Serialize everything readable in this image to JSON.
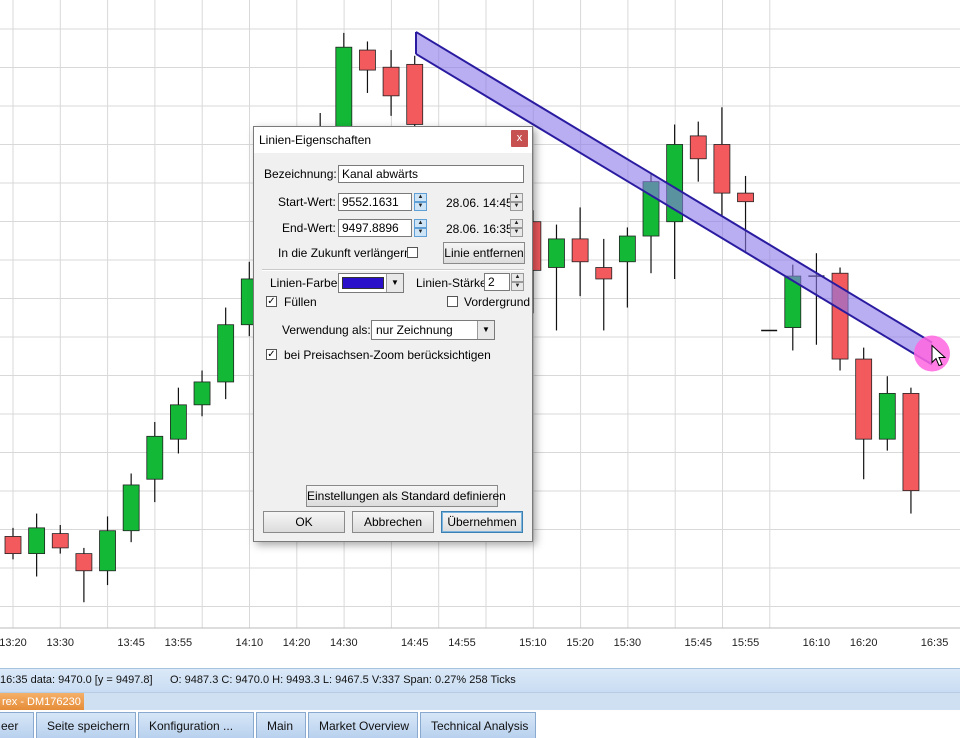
{
  "chart_data": {
    "type": "candlestick",
    "x_ticks": [
      "13:20",
      "13:30",
      "13:45",
      "13:55",
      "14:10",
      "14:20",
      "14:30",
      "14:45",
      "14:55",
      "15:10",
      "15:20",
      "15:30",
      "15:45",
      "15:55",
      "16:10",
      "16:20",
      "16:35"
    ],
    "ylim": [
      9448,
      9556
    ],
    "colors": {
      "up": "#12b836",
      "down": "#f25a5e",
      "grid": "#d9d9d9",
      "channel_fill": "#8a78e8",
      "channel_edge": "#2a1ca0",
      "cursor": "#ff66e0"
    },
    "candles": [
      {
        "x": 0,
        "o": 9464.0,
        "h": 9465.5,
        "l": 9460.0,
        "c": 9461.0
      },
      {
        "x": 1,
        "o": 9461.0,
        "h": 9468.0,
        "l": 9457.0,
        "c": 9465.5
      },
      {
        "x": 2,
        "o": 9464.5,
        "h": 9466.0,
        "l": 9461.0,
        "c": 9462.0
      },
      {
        "x": 3,
        "o": 9461.0,
        "h": 9462.0,
        "l": 9452.5,
        "c": 9458.0
      },
      {
        "x": 4,
        "o": 9458.0,
        "h": 9467.5,
        "l": 9455.5,
        "c": 9465.0
      },
      {
        "x": 5,
        "o": 9465.0,
        "h": 9475.0,
        "l": 9463.0,
        "c": 9473.0
      },
      {
        "x": 6,
        "o": 9474.0,
        "h": 9484.0,
        "l": 9470.0,
        "c": 9481.5
      },
      {
        "x": 7,
        "o": 9481.0,
        "h": 9490.0,
        "l": 9478.5,
        "c": 9487.0
      },
      {
        "x": 8,
        "o": 9487.0,
        "h": 9493.0,
        "l": 9485.0,
        "c": 9491.0
      },
      {
        "x": 9,
        "o": 9491.0,
        "h": 9504.0,
        "l": 9488.0,
        "c": 9501.0
      },
      {
        "x": 10,
        "o": 9501.0,
        "h": 9512.0,
        "l": 9499.0,
        "c": 9509.0
      },
      {
        "x": 11,
        "o": 9509.0,
        "h": 9520.0,
        "l": 9507.0,
        "c": 9518.0
      },
      {
        "x": 12,
        "o": 9520.0,
        "h": 9530.0,
        "l": 9518.0,
        "c": 9528.0
      },
      {
        "x": 13,
        "o": 9528.0,
        "h": 9538.0,
        "l": 9526.0,
        "c": 9535.0
      },
      {
        "x": 14,
        "o": 9535.0,
        "h": 9552.0,
        "l": 9534.0,
        "c": 9549.5
      },
      {
        "x": 15,
        "o": 9549.0,
        "h": 9550.5,
        "l": 9541.5,
        "c": 9545.5
      },
      {
        "x": 16,
        "o": 9546.0,
        "h": 9549.0,
        "l": 9537.5,
        "c": 9541.0
      },
      {
        "x": 17,
        "o": 9546.5,
        "h": 9548.0,
        "l": 9532.5,
        "c": 9536.0
      },
      {
        "x": 18,
        "o": 9535.0,
        "h": 9535.5,
        "l": 9526.0,
        "c": 9530.0
      },
      {
        "x": 19,
        "o": 9528.0,
        "h": 9529.0,
        "l": 9513.0,
        "c": 9521.0
      },
      {
        "x": 20,
        "o": 9519.0,
        "h": 9523.0,
        "l": 9504.5,
        "c": 9511.0
      },
      {
        "x": 21,
        "o": 9511.5,
        "h": 9522.0,
        "l": 9504.0,
        "c": 9519.5
      },
      {
        "x": 22,
        "o": 9519.0,
        "h": 9521.0,
        "l": 9503.0,
        "c": 9510.5
      },
      {
        "x": 23,
        "o": 9511.0,
        "h": 9518.5,
        "l": 9500.0,
        "c": 9516.0
      },
      {
        "x": 24,
        "o": 9516.0,
        "h": 9521.5,
        "l": 9506.0,
        "c": 9512.0
      },
      {
        "x": 25,
        "o": 9511.0,
        "h": 9516.0,
        "l": 9500.0,
        "c": 9509.0
      },
      {
        "x": 26,
        "o": 9512.0,
        "h": 9518.0,
        "l": 9504.0,
        "c": 9516.5
      },
      {
        "x": 27,
        "o": 9516.5,
        "h": 9527.5,
        "l": 9510.0,
        "c": 9526.0
      },
      {
        "x": 28,
        "o": 9519.0,
        "h": 9536.0,
        "l": 9509.0,
        "c": 9532.5
      },
      {
        "x": 29,
        "o": 9534.0,
        "h": 9536.5,
        "l": 9526.0,
        "c": 9530.0
      },
      {
        "x": 30,
        "o": 9532.5,
        "h": 9539.0,
        "l": 9520.0,
        "c": 9524.0
      },
      {
        "x": 31,
        "o": 9524.0,
        "h": 9527.0,
        "l": 9513.5,
        "c": 9522.5
      },
      {
        "x": 32,
        "o": 9500.0,
        "h": 9500.0,
        "l": 9500.0,
        "c": 9500.0
      },
      {
        "x": 33,
        "o": 9500.5,
        "h": 9511.5,
        "l": 9496.5,
        "c": 9509.5
      },
      {
        "x": 34,
        "o": 9509.5,
        "h": 9513.5,
        "l": 9497.5,
        "c": 9509.5
      },
      {
        "x": 35,
        "o": 9510.0,
        "h": 9511.0,
        "l": 9493.0,
        "c": 9495.0
      },
      {
        "x": 36,
        "o": 9495.0,
        "h": 9497.0,
        "l": 9474.0,
        "c": 9481.0
      },
      {
        "x": 37,
        "o": 9481.0,
        "h": 9492.0,
        "l": 9479.0,
        "c": 9489.0
      },
      {
        "x": 38,
        "o": 9489.0,
        "h": 9490.0,
        "l": 9468.0,
        "c": 9472.0
      }
    ],
    "channel": {
      "start_value": 9552.1631,
      "end_value": 9497.8896,
      "start_time": "14:45",
      "end_time": "16:35"
    }
  },
  "status": {
    "left": "16:35 data: 9470.0 [y = 9497.8]",
    "right": "O: 9487.3 C: 9470.0 H: 9493.3 L: 9467.5 V:337 Span: 0.27% 258 Ticks"
  },
  "taskbar": {
    "window": "rex - DM176230"
  },
  "tabs": [
    "eer",
    "Seite speichern",
    "Konfiguration ...",
    "Main",
    "Market Overview",
    "Technical Analysis"
  ],
  "dialog": {
    "title": "Linien-Eigenschaften",
    "close": "x",
    "bezeichnung_label": "Bezeichnung:",
    "bezeichnung_value": "Kanal abwärts",
    "start_label": "Start-Wert:",
    "start_value": "9552.1631",
    "start_time": "28.06. 14:45",
    "end_label": "End-Wert:",
    "end_value": "9497.8896",
    "end_time": "28.06. 16:35",
    "extend_label": "In die Zukunft verlängern:",
    "remove_button": "Linie entfernen",
    "color_label": "Linien-Farbe:",
    "line_color": "#2a10c8",
    "width_label": "Linien-Stärke:",
    "width_value": "2",
    "fill_check": "✓",
    "fill_label": "Füllen",
    "foreground_label": "Vordergrund",
    "usage_label": "Verwendung als:",
    "usage_value": "nur Zeichnung",
    "zoom_check": "✓",
    "zoom_label": "bei Preisachsen-Zoom berücksichtigen",
    "default_button": "Einstellungen als Standard definieren",
    "ok_button": "OK",
    "cancel_button": "Abbrechen",
    "apply_button": "Übernehmen"
  }
}
